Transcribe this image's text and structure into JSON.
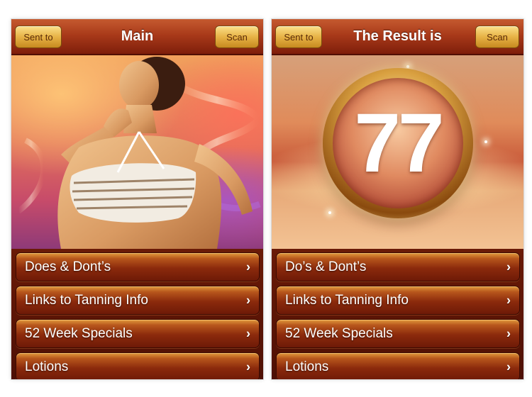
{
  "left_screen": {
    "nav": {
      "left_button": "Sent to",
      "title": "Main",
      "right_button": "Scan"
    },
    "hero_image": "bikini-model-photo",
    "menu": [
      {
        "label": "Does & Dont’s",
        "icon": "chevron-right-icon"
      },
      {
        "label": "Links to Tanning Info",
        "icon": "chevron-right-icon"
      },
      {
        "label": "52 Week Specials",
        "icon": "chevron-right-icon"
      },
      {
        "label": "Lotions",
        "icon": "chevron-right-icon"
      }
    ]
  },
  "right_screen": {
    "nav": {
      "left_button": "Sent to",
      "title": "The Result is",
      "right_button": "Scan"
    },
    "result": {
      "score": "77"
    },
    "menu": [
      {
        "label": "Do’s & Dont’s",
        "icon": "chevron-right-icon"
      },
      {
        "label": "Links to Tanning Info",
        "icon": "chevron-right-icon"
      },
      {
        "label": "52 Week Specials",
        "icon": "chevron-right-icon"
      },
      {
        "label": "Lotions",
        "icon": "chevron-right-icon"
      }
    ]
  },
  "colors": {
    "navbar": "#a93a1a",
    "button_gold": "#e7b246",
    "menu_dark": "#6e1a07",
    "text": "#ffffff"
  },
  "chevron_glyph": "›"
}
